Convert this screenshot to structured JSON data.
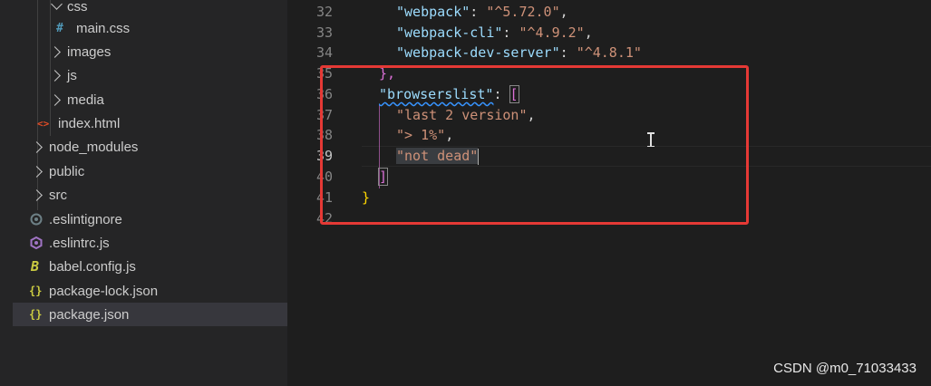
{
  "explorer": {
    "items": [
      {
        "label": "css",
        "icon": "folder-open"
      },
      {
        "label": "main.css",
        "icon": "css-file",
        "glyph": "#"
      },
      {
        "label": "images",
        "icon": "folder-closed"
      },
      {
        "label": "js",
        "icon": "folder-closed"
      },
      {
        "label": "media",
        "icon": "folder-closed"
      },
      {
        "label": "index.html",
        "icon": "html-file",
        "glyph": "<>"
      },
      {
        "label": "node_modules",
        "icon": "folder-closed"
      },
      {
        "label": "public",
        "icon": "folder-closed"
      },
      {
        "label": "src",
        "icon": "folder-closed"
      },
      {
        "label": ".eslintignore",
        "icon": "eslint-ignore-file"
      },
      {
        "label": ".eslintrc.js",
        "icon": "eslint-file"
      },
      {
        "label": "babel.config.js",
        "icon": "babel-file",
        "glyph": "B"
      },
      {
        "label": "package-lock.json",
        "icon": "json-file",
        "glyph": "{}"
      },
      {
        "label": "package.json",
        "icon": "json-file",
        "glyph": "{}"
      }
    ],
    "selected": "package.json"
  },
  "editor": {
    "line_numbers": [
      "32",
      "33",
      "34",
      "35",
      "36",
      "37",
      "38",
      "39",
      "40",
      "41",
      "42"
    ],
    "lines": {
      "l32_key": "\"webpack\"",
      "l32_val": "\"^5.72.0\"",
      "l33_key": "\"webpack-cli\"",
      "l33_val": "\"^4.9.2\"",
      "l34_key": "\"webpack-dev-server\"",
      "l34_val": "\"^4.8.1\"",
      "l35": "},",
      "l36_key": "\"browserslist\"",
      "l36_open": "[",
      "l37": "\"last 2 version\"",
      "l38": "\"> 1%\"",
      "l39": "\"not dead\"",
      "l40": "]",
      "l41": "}"
    },
    "punct": {
      "colon": ": ",
      "comma": ","
    }
  },
  "colors": {
    "highlight_border": "#e53935",
    "json_key": "#9cdcfe",
    "json_string": "#ce9178"
  },
  "watermark": "CSDN @m0_71033433"
}
